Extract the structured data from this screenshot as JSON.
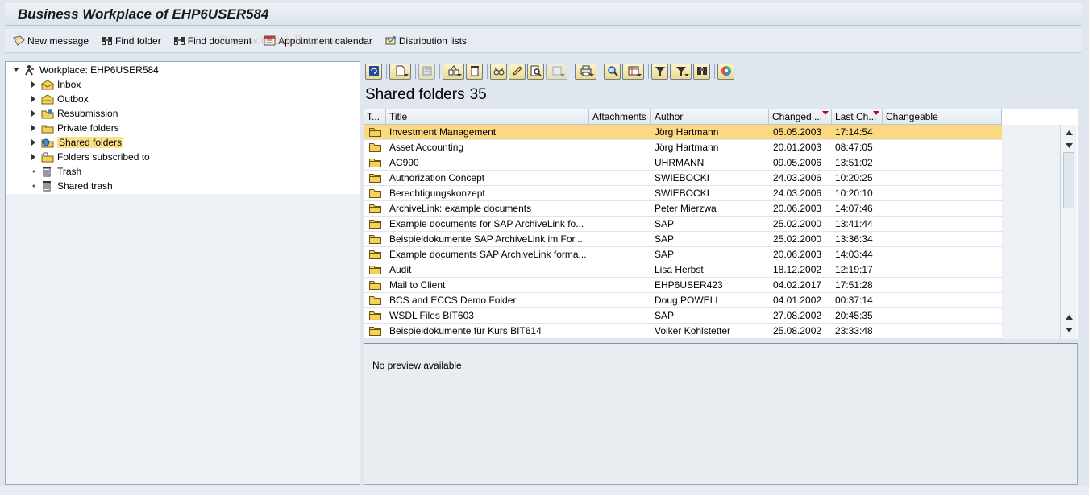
{
  "window": {
    "title": "Business Workplace of EHP6USER584"
  },
  "app_toolbar": [
    {
      "label": "New message",
      "icon": "new-message-icon"
    },
    {
      "label": "Find folder",
      "icon": "binoculars-icon"
    },
    {
      "label": "Find document",
      "icon": "binoculars-icon"
    },
    {
      "label": "Appointment calendar",
      "icon": "calendar-icon"
    },
    {
      "label": "Distribution lists",
      "icon": "distribution-list-icon"
    }
  ],
  "watermark": "© www.tutorialkart.com",
  "tree": {
    "root": "Workplace: EHP6USER584",
    "items": [
      {
        "label": "Inbox",
        "icon": "inbox-icon"
      },
      {
        "label": "Outbox",
        "icon": "outbox-icon"
      },
      {
        "label": "Resubmission",
        "icon": "resubmission-icon"
      },
      {
        "label": "Private folders",
        "icon": "private-folders-icon"
      },
      {
        "label": "Shared folders",
        "icon": "shared-folders-icon",
        "selected": true
      },
      {
        "label": "Folders subscribed to",
        "icon": "subscribed-folders-icon"
      },
      {
        "label": "Trash",
        "icon": "trash-icon"
      },
      {
        "label": "Shared trash",
        "icon": "trash-icon"
      }
    ]
  },
  "grid": {
    "title": "Shared folders",
    "count": "35",
    "columns": [
      "T...",
      "Title",
      "Attachments",
      "Author",
      "Changed ...",
      "Last Ch...",
      "Changeable"
    ],
    "rows": [
      {
        "title": "Investment Management",
        "author": "Jörg Hartmann",
        "changed": "05.05.2003",
        "time": "17:14:54"
      },
      {
        "title": "Asset Accounting",
        "author": "Jörg Hartmann",
        "changed": "20.01.2003",
        "time": "08:47:05"
      },
      {
        "title": "AC990",
        "author": "UHRMANN",
        "changed": "09.05.2006",
        "time": "13:51:02"
      },
      {
        "title": "Authorization Concept",
        "author": "SWIEBOCKI",
        "changed": "24.03.2006",
        "time": "10:20:25"
      },
      {
        "title": "Berechtigungskonzept",
        "author": "SWIEBOCKI",
        "changed": "24.03.2006",
        "time": "10:20:10"
      },
      {
        "title": "ArchiveLink: example documents",
        "author": "Peter Mierzwa",
        "changed": "20.06.2003",
        "time": "14:07:46"
      },
      {
        "title": "Example documents for SAP ArchiveLink fo...",
        "author": "SAP",
        "changed": "25.02.2000",
        "time": "13:41:44"
      },
      {
        "title": "Beispieldokumente SAP ArchiveLink im For...",
        "author": "SAP",
        "changed": "25.02.2000",
        "time": "13:36:34"
      },
      {
        "title": "Example documents SAP ArchiveLink forma...",
        "author": "SAP",
        "changed": "20.06.2003",
        "time": "14:03:44"
      },
      {
        "title": "Audit",
        "author": "Lisa Herbst",
        "changed": "18.12.2002",
        "time": "12:19:17"
      },
      {
        "title": "Mail to Client",
        "author": "EHP6USER423",
        "changed": "04.02.2017",
        "time": "17:51:28"
      },
      {
        "title": "BCS and ECCS Demo Folder",
        "author": "Doug POWELL",
        "changed": "04.01.2002",
        "time": "00:37:14"
      },
      {
        "title": "WSDL Files  BIT603",
        "author": "SAP",
        "changed": "27.08.2002",
        "time": "20:45:35"
      },
      {
        "title": "Beispieldokumente für Kurs BIT614",
        "author": "Volker Kohlstetter",
        "changed": "25.08.2002",
        "time": "23:33:48"
      }
    ]
  },
  "preview": {
    "message": "No preview available."
  },
  "colors": {
    "selected_row": "#fcd880",
    "selected_tree": "#ffe08a",
    "background": "#dfe6ee",
    "folder": "#f3d25a"
  }
}
